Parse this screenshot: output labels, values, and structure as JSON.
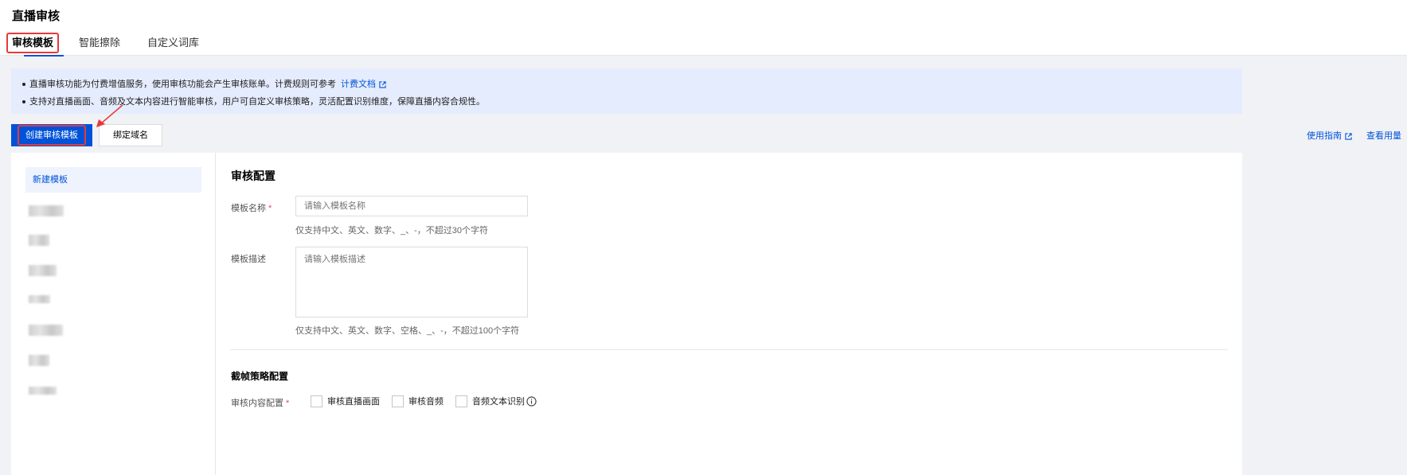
{
  "page": {
    "title": "直播审核"
  },
  "tabs": [
    {
      "label": "审核模板",
      "active": true
    },
    {
      "label": "智能擦除",
      "active": false
    },
    {
      "label": "自定义词库",
      "active": false
    }
  ],
  "notice": {
    "line1_text": "直播审核功能为付费增值服务，使用审核功能会产生审核账单。计费规则可参考",
    "line1_link": "计费文档",
    "line2_text": "支持对直播画面、音频及文本内容进行智能审核，用户可自定义审核策略，灵活配置识别维度，保障直播内容合规性。"
  },
  "toolbar": {
    "create_button": "创建审核模板",
    "bind_domain_button": "绑定域名",
    "guide_link": "使用指南",
    "usage_link": "查看用量"
  },
  "sidebar": {
    "active_item": "新建模板",
    "blurred_item_count_note": "7 redacted template names"
  },
  "form": {
    "section_title": "审核配置",
    "name_label": "模板名称",
    "name_placeholder": "请输入模板名称",
    "name_hint": "仅支持中文、英文、数字、_、-，不超过30个字符",
    "desc_label": "模板描述",
    "desc_placeholder": "请输入模板描述",
    "desc_hint": "仅支持中文、英文、数字、空格、_、-，不超过100个字符",
    "frame_section_title": "截帧策略配置",
    "content_config_label": "审核内容配置",
    "checkboxes": [
      {
        "label": "审核直播画面",
        "checked": false
      },
      {
        "label": "审核音频",
        "checked": false
      },
      {
        "label": "音频文本识别",
        "checked": false
      }
    ]
  },
  "colors": {
    "accent": "#0052d9",
    "highlight_box": "#e63a3a",
    "notice_bg": "#e5ecfd"
  }
}
